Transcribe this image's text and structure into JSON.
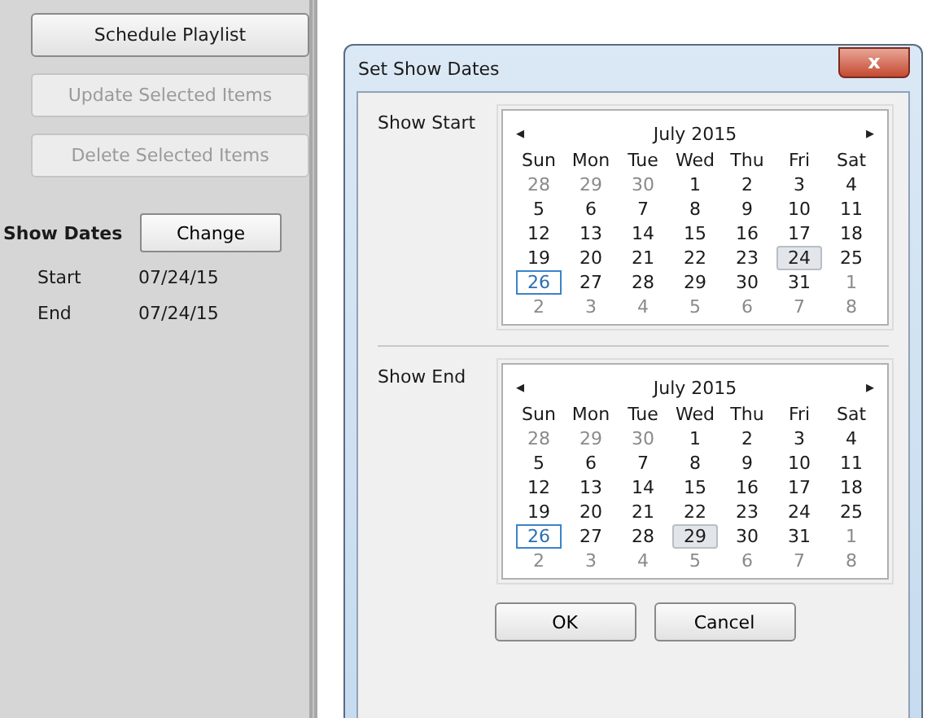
{
  "sidebar": {
    "buttons": [
      {
        "label": "Schedule Playlist",
        "disabled": false
      },
      {
        "label": "Update Selected Items",
        "disabled": true
      },
      {
        "label": "Delete Selected Items",
        "disabled": true
      }
    ],
    "show_dates": {
      "label": "Show Dates",
      "button": "Change",
      "rows": [
        {
          "label": "Start",
          "value": "07/24/15"
        },
        {
          "label": "End",
          "value": "07/24/15"
        }
      ]
    }
  },
  "dialog": {
    "title": "Set Show Dates",
    "close": "x",
    "calendars": [
      {
        "label": "Show Start",
        "prev": "◂",
        "next": "▸",
        "month": "July 2015",
        "weekdays": [
          "Sun",
          "Mon",
          "Tue",
          "Wed",
          "Thu",
          "Fri",
          "Sat"
        ],
        "weeks": [
          [
            {
              "label": "28",
              "muted": true,
              "today": false,
              "selected": false
            },
            {
              "label": "29",
              "muted": true,
              "today": false,
              "selected": false
            },
            {
              "label": "30",
              "muted": true,
              "today": false,
              "selected": false
            },
            {
              "label": "1",
              "muted": false,
              "today": false,
              "selected": false
            },
            {
              "label": "2",
              "muted": false,
              "today": false,
              "selected": false
            },
            {
              "label": "3",
              "muted": false,
              "today": false,
              "selected": false
            },
            {
              "label": "4",
              "muted": false,
              "today": false,
              "selected": false
            }
          ],
          [
            {
              "label": "5",
              "muted": false,
              "today": false,
              "selected": false
            },
            {
              "label": "6",
              "muted": false,
              "today": false,
              "selected": false
            },
            {
              "label": "7",
              "muted": false,
              "today": false,
              "selected": false
            },
            {
              "label": "8",
              "muted": false,
              "today": false,
              "selected": false
            },
            {
              "label": "9",
              "muted": false,
              "today": false,
              "selected": false
            },
            {
              "label": "10",
              "muted": false,
              "today": false,
              "selected": false
            },
            {
              "label": "11",
              "muted": false,
              "today": false,
              "selected": false
            }
          ],
          [
            {
              "label": "12",
              "muted": false,
              "today": false,
              "selected": false
            },
            {
              "label": "13",
              "muted": false,
              "today": false,
              "selected": false
            },
            {
              "label": "14",
              "muted": false,
              "today": false,
              "selected": false
            },
            {
              "label": "15",
              "muted": false,
              "today": false,
              "selected": false
            },
            {
              "label": "16",
              "muted": false,
              "today": false,
              "selected": false
            },
            {
              "label": "17",
              "muted": false,
              "today": false,
              "selected": false
            },
            {
              "label": "18",
              "muted": false,
              "today": false,
              "selected": false
            }
          ],
          [
            {
              "label": "19",
              "muted": false,
              "today": false,
              "selected": false
            },
            {
              "label": "20",
              "muted": false,
              "today": false,
              "selected": false
            },
            {
              "label": "21",
              "muted": false,
              "today": false,
              "selected": false
            },
            {
              "label": "22",
              "muted": false,
              "today": false,
              "selected": false
            },
            {
              "label": "23",
              "muted": false,
              "today": false,
              "selected": false
            },
            {
              "label": "24",
              "muted": false,
              "today": false,
              "selected": true
            },
            {
              "label": "25",
              "muted": false,
              "today": false,
              "selected": false
            }
          ],
          [
            {
              "label": "26",
              "muted": false,
              "today": true,
              "selected": false
            },
            {
              "label": "27",
              "muted": false,
              "today": false,
              "selected": false
            },
            {
              "label": "28",
              "muted": false,
              "today": false,
              "selected": false
            },
            {
              "label": "29",
              "muted": false,
              "today": false,
              "selected": false
            },
            {
              "label": "30",
              "muted": false,
              "today": false,
              "selected": false
            },
            {
              "label": "31",
              "muted": false,
              "today": false,
              "selected": false
            },
            {
              "label": "1",
              "muted": true,
              "today": false,
              "selected": false
            }
          ],
          [
            {
              "label": "2",
              "muted": true,
              "today": false,
              "selected": false
            },
            {
              "label": "3",
              "muted": true,
              "today": false,
              "selected": false
            },
            {
              "label": "4",
              "muted": true,
              "today": false,
              "selected": false
            },
            {
              "label": "5",
              "muted": true,
              "today": false,
              "selected": false
            },
            {
              "label": "6",
              "muted": true,
              "today": false,
              "selected": false
            },
            {
              "label": "7",
              "muted": true,
              "today": false,
              "selected": false
            },
            {
              "label": "8",
              "muted": true,
              "today": false,
              "selected": false
            }
          ]
        ]
      },
      {
        "label": "Show End",
        "prev": "◂",
        "next": "▸",
        "month": "July 2015",
        "weekdays": [
          "Sun",
          "Mon",
          "Tue",
          "Wed",
          "Thu",
          "Fri",
          "Sat"
        ],
        "weeks": [
          [
            {
              "label": "28",
              "muted": true,
              "today": false,
              "selected": false
            },
            {
              "label": "29",
              "muted": true,
              "today": false,
              "selected": false
            },
            {
              "label": "30",
              "muted": true,
              "today": false,
              "selected": false
            },
            {
              "label": "1",
              "muted": false,
              "today": false,
              "selected": false
            },
            {
              "label": "2",
              "muted": false,
              "today": false,
              "selected": false
            },
            {
              "label": "3",
              "muted": false,
              "today": false,
              "selected": false
            },
            {
              "label": "4",
              "muted": false,
              "today": false,
              "selected": false
            }
          ],
          [
            {
              "label": "5",
              "muted": false,
              "today": false,
              "selected": false
            },
            {
              "label": "6",
              "muted": false,
              "today": false,
              "selected": false
            },
            {
              "label": "7",
              "muted": false,
              "today": false,
              "selected": false
            },
            {
              "label": "8",
              "muted": false,
              "today": false,
              "selected": false
            },
            {
              "label": "9",
              "muted": false,
              "today": false,
              "selected": false
            },
            {
              "label": "10",
              "muted": false,
              "today": false,
              "selected": false
            },
            {
              "label": "11",
              "muted": false,
              "today": false,
              "selected": false
            }
          ],
          [
            {
              "label": "12",
              "muted": false,
              "today": false,
              "selected": false
            },
            {
              "label": "13",
              "muted": false,
              "today": false,
              "selected": false
            },
            {
              "label": "14",
              "muted": false,
              "today": false,
              "selected": false
            },
            {
              "label": "15",
              "muted": false,
              "today": false,
              "selected": false
            },
            {
              "label": "16",
              "muted": false,
              "today": false,
              "selected": false
            },
            {
              "label": "17",
              "muted": false,
              "today": false,
              "selected": false
            },
            {
              "label": "18",
              "muted": false,
              "today": false,
              "selected": false
            }
          ],
          [
            {
              "label": "19",
              "muted": false,
              "today": false,
              "selected": false
            },
            {
              "label": "20",
              "muted": false,
              "today": false,
              "selected": false
            },
            {
              "label": "21",
              "muted": false,
              "today": false,
              "selected": false
            },
            {
              "label": "22",
              "muted": false,
              "today": false,
              "selected": false
            },
            {
              "label": "23",
              "muted": false,
              "today": false,
              "selected": false
            },
            {
              "label": "24",
              "muted": false,
              "today": false,
              "selected": false
            },
            {
              "label": "25",
              "muted": false,
              "today": false,
              "selected": false
            }
          ],
          [
            {
              "label": "26",
              "muted": false,
              "today": true,
              "selected": false
            },
            {
              "label": "27",
              "muted": false,
              "today": false,
              "selected": false
            },
            {
              "label": "28",
              "muted": false,
              "today": false,
              "selected": false
            },
            {
              "label": "29",
              "muted": false,
              "today": false,
              "selected": true
            },
            {
              "label": "30",
              "muted": false,
              "today": false,
              "selected": false
            },
            {
              "label": "31",
              "muted": false,
              "today": false,
              "selected": false
            },
            {
              "label": "1",
              "muted": true,
              "today": false,
              "selected": false
            }
          ],
          [
            {
              "label": "2",
              "muted": true,
              "today": false,
              "selected": false
            },
            {
              "label": "3",
              "muted": true,
              "today": false,
              "selected": false
            },
            {
              "label": "4",
              "muted": true,
              "today": false,
              "selected": false
            },
            {
              "label": "5",
              "muted": true,
              "today": false,
              "selected": false
            },
            {
              "label": "6",
              "muted": true,
              "today": false,
              "selected": false
            },
            {
              "label": "7",
              "muted": true,
              "today": false,
              "selected": false
            },
            {
              "label": "8",
              "muted": true,
              "today": false,
              "selected": false
            }
          ]
        ]
      }
    ],
    "buttons": [
      "OK",
      "Cancel"
    ]
  }
}
